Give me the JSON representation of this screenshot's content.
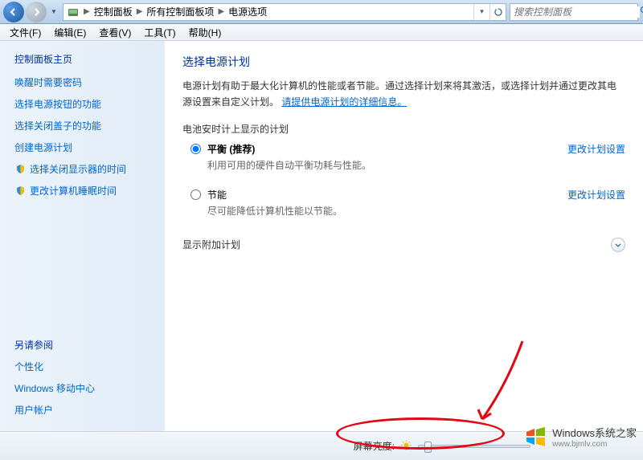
{
  "nav": {
    "breadcrumb": [
      "控制面板",
      "所有控制面板项",
      "电源选项"
    ],
    "search_placeholder": "搜索控制面板"
  },
  "menu": {
    "items": [
      "文件(F)",
      "编辑(E)",
      "查看(V)",
      "工具(T)",
      "帮助(H)"
    ]
  },
  "sidebar": {
    "home": "控制面板主页",
    "links": [
      "唤醒时需要密码",
      "选择电源按钮的功能",
      "选择关闭盖子的功能",
      "创建电源计划",
      "选择关闭显示器的时间",
      "更改计算机睡眠时间"
    ],
    "see_also_title": "另请参阅",
    "see_also": [
      "个性化",
      "Windows 移动中心",
      "用户帐户"
    ]
  },
  "content": {
    "title": "选择电源计划",
    "desc_pre": "电源计划有助于最大化计算机的性能或者节能。通过选择计划来将其激活，或选择计划并通过更改其电源设置来自定义计划。",
    "desc_link": "请提供电源计划的详细信息。",
    "section_label": "电池安时计上显示的计划",
    "plans": [
      {
        "name": "平衡 (推荐)",
        "desc": "利用可用的硬件自动平衡功耗与性能。",
        "link": "更改计划设置",
        "selected": true
      },
      {
        "name": "节能",
        "desc": "尽可能降低计算机性能以节能。",
        "link": "更改计划设置",
        "selected": false
      }
    ],
    "expand_label": "显示附加计划"
  },
  "bottom": {
    "brightness_label": "屏幕亮度:"
  },
  "watermark": {
    "title": "Windows系统之家",
    "url": "www.bjmlv.com"
  }
}
